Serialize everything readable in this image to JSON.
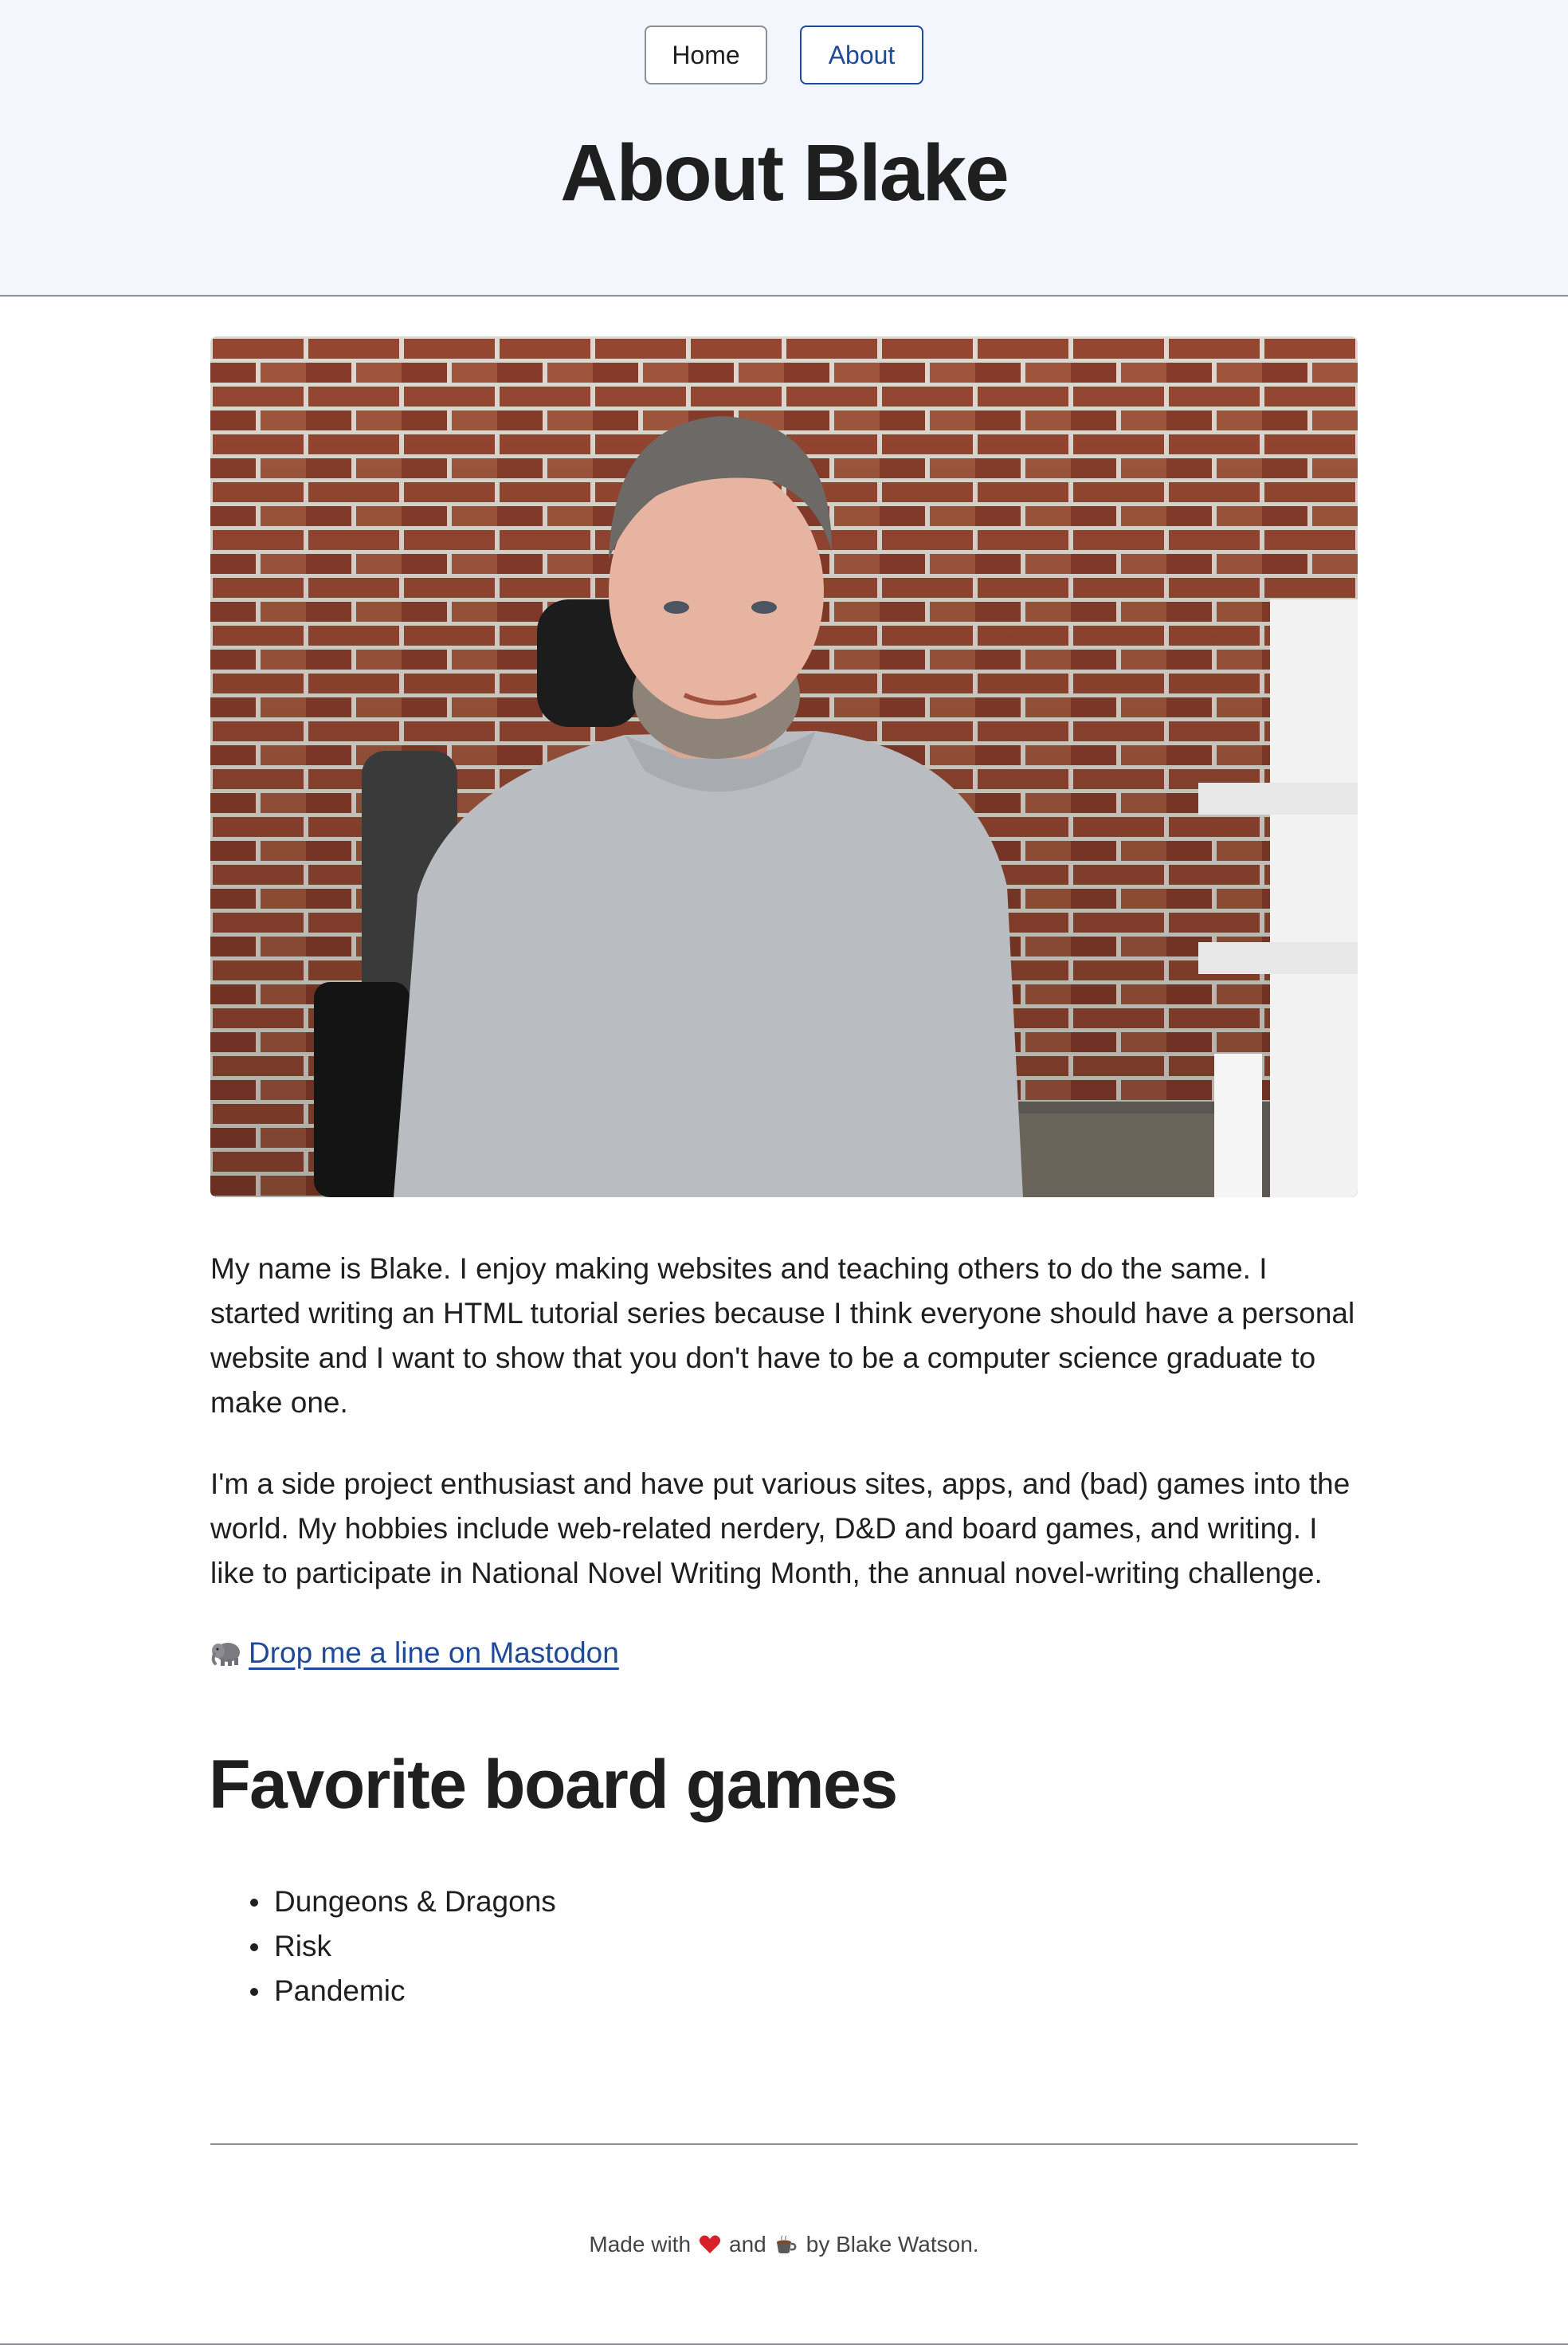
{
  "nav": {
    "home_label": "Home",
    "about_label": "About"
  },
  "header": {
    "title": "About Blake"
  },
  "photo": {
    "alt_subject": "portrait-photo"
  },
  "content": {
    "paragraph_1": "My name is Blake. I enjoy making websites and teaching others to do the same. I started writing an HTML tutorial series because I think everyone should have a personal website and I want to show that you don't have to be a computer science graduate to make one.",
    "paragraph_2": "I'm a side project enthusiast and have put various sites, apps, and (bad) games into the world. My hobbies include web-related nerdery, D&D and board games, and writing. I like to participate in National Novel Writing Month, the annual novel-writing challenge.",
    "mastodon_link": "Drop me a line on Mastodon"
  },
  "board_games": {
    "title": "Favorite board games",
    "items": [
      "Dungeons & Dragons",
      "Risk",
      "Pandemic"
    ]
  },
  "footer": {
    "made_with": "Made with",
    "and": "and",
    "by": "by Blake Watson."
  },
  "colors": {
    "header_bg": "#f3f6fd",
    "link": "#1f4a9a",
    "text": "#1f1f1f",
    "rule": "#8a8f98"
  }
}
